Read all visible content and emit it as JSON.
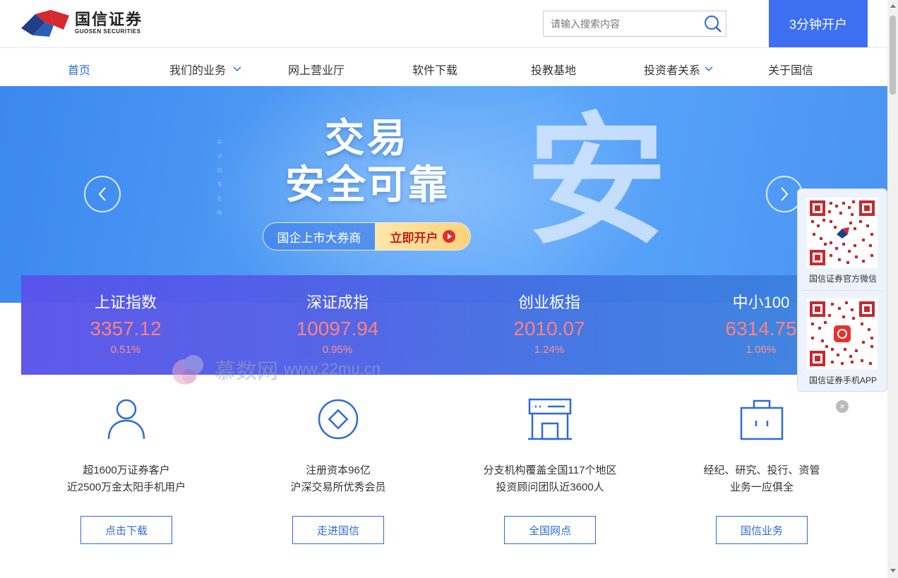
{
  "brand": {
    "name_cn": "国信证券",
    "name_en": "GUOSEN SECURITIES"
  },
  "search": {
    "placeholder": "请输入搜索内容"
  },
  "header": {
    "open_account_label": "3分钟开户"
  },
  "nav": {
    "items": [
      {
        "label": "首页"
      },
      {
        "label": "我们的业务"
      },
      {
        "label": "网上营业厅"
      },
      {
        "label": "软件下载"
      },
      {
        "label": "投教基地"
      },
      {
        "label": "投资者关系"
      },
      {
        "label": "关于国信"
      }
    ]
  },
  "banner": {
    "vertical_text": "GUOSEN",
    "headline_line1": "交易",
    "headline_line2": "安全可靠",
    "pill_left": "国企上市大券商",
    "pill_right": "立即开户",
    "big_char": "安"
  },
  "indices": [
    {
      "name": "上证指数",
      "value": "3357.12",
      "change": "0.51%"
    },
    {
      "name": "深证成指",
      "value": "10097.94",
      "change": "0.95%"
    },
    {
      "name": "创业板指",
      "value": "2010.07",
      "change": "1.24%"
    },
    {
      "name": "中小100",
      "value": "6314.75",
      "change": "1.06%"
    }
  ],
  "qr": {
    "wechat_label": "国信证券官方微信",
    "app_label": "国信证券手机APP"
  },
  "watermark": {
    "text": "慕数网",
    "url": "www.22mu.cn"
  },
  "features": [
    {
      "line1": "超1600万证券客户",
      "line2": "近2500万金太阳手机用户",
      "button": "点击下载"
    },
    {
      "line1": "注册资本96亿",
      "line2": "沪深交易所优秀会员",
      "button": "走进国信"
    },
    {
      "line1": "分支机构覆盖全国117个地区",
      "line2": "投资顾问团队近3600人",
      "button": "全国网点"
    },
    {
      "line1": "经纪、研究、投行、资管",
      "line2": "业务一应俱全",
      "button": "国信业务"
    }
  ],
  "colors": {
    "accent": "#3d6ff0",
    "link": "#2f6ad9",
    "index_up": "#ff7d7d"
  }
}
